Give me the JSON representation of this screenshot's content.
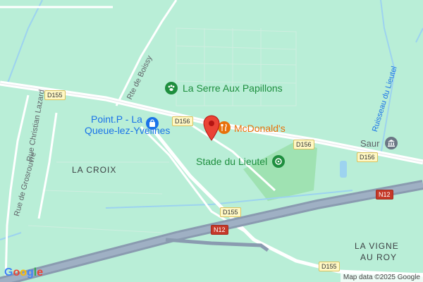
{
  "map": {
    "pois": {
      "serre": "La Serre Aux Papillons",
      "pointp_line1": "Point.P - La",
      "pointp_line2": "Queue-lez-Yvelines",
      "mcdonalds": "McDonald's",
      "stade": "Stade du Lieutel",
      "saur": "Saur"
    },
    "areas": {
      "la_croix": "LA CROIX",
      "vigne_line1": "LA VIGNE",
      "vigne_line2": "AU ROY"
    },
    "streets": {
      "rte_boissy": "Rte de Boissy",
      "christian_lazard": "Rue Christian Lazard",
      "grosrouvre": "Rue de Grosrouvre"
    },
    "water": {
      "ruisseau": "Ruisseau du Lieutel"
    },
    "shields": {
      "d155_a": "D155",
      "d156_a": "D156",
      "d156_b": "D156",
      "d156_c": "D156",
      "d155_b": "D155",
      "d155_c": "D155",
      "n12_a": "N12",
      "n12_b": "N12"
    },
    "attribution": "Map data ©2025 Google",
    "logo": "Google"
  },
  "icons": {
    "pin": "map-pin-icon",
    "butterfly": "paw-icon",
    "store": "shopping-bag-icon",
    "food": "fork-knife-icon",
    "stadium": "stadium-icon",
    "museum": "landmark-icon"
  },
  "colors": {
    "base": "#b9eed7",
    "park": "#a4e3b8",
    "road": "#ffffff",
    "major_road": "#8a9bb0",
    "water": "#9dd3ef",
    "pin": "#ea4335",
    "poi_green": "#1e8e3e",
    "poi_blue": "#1a73e8",
    "poi_orange": "#e8710a"
  }
}
